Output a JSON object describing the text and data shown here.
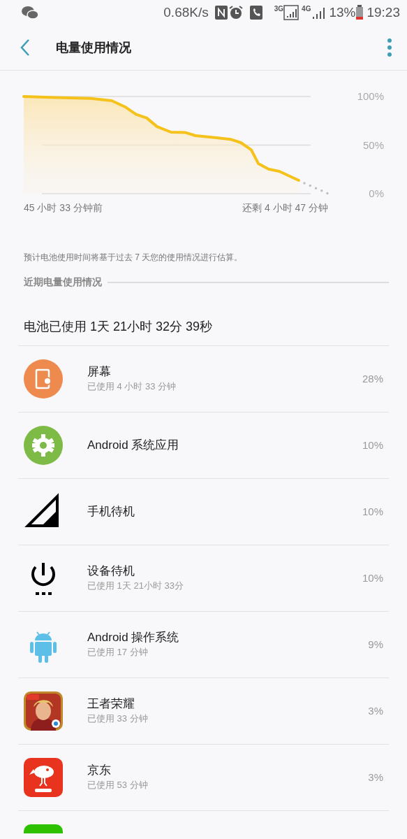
{
  "status_bar": {
    "speed": "0.68K/s",
    "network_3g": "3G",
    "network_4g": "4G",
    "battery": "13%",
    "time": "19:23"
  },
  "header": {
    "title": "电量使用情况"
  },
  "chart": {
    "y_labels": [
      "100%",
      "50%",
      "0%"
    ],
    "start_label": "45 小时 33 分钟前",
    "end_label": "还剩 4 小时 47 分钟"
  },
  "note": "预计电池使用时间将基于过去 7 天您的使用情况进行估算。",
  "section_title": "近期电量使用情况",
  "summary": "电池已使用 1天 21小时 32分 39秒",
  "items": [
    {
      "kind": "screen",
      "name": "屏幕",
      "usage": "已使用 4 小时 33 分钟",
      "percent": "28%"
    },
    {
      "kind": "gear",
      "name": "Android 系统应用",
      "percent": "10%"
    },
    {
      "kind": "signal",
      "name": "手机待机",
      "percent": "10%"
    },
    {
      "kind": "power",
      "name": "设备待机",
      "usage": "已使用 1天 21小时 33分",
      "percent": "10%"
    },
    {
      "kind": "android",
      "name": "Android 操作系统",
      "usage": "已使用 17 分钟",
      "percent": "9%"
    },
    {
      "kind": "game",
      "name": "王者荣耀",
      "usage": "已使用 33 分钟",
      "percent": "3%"
    },
    {
      "kind": "shop",
      "name": "京东",
      "usage": "已使用 53 分钟",
      "percent": "3%"
    },
    {
      "kind": "chat"
    }
  ]
}
